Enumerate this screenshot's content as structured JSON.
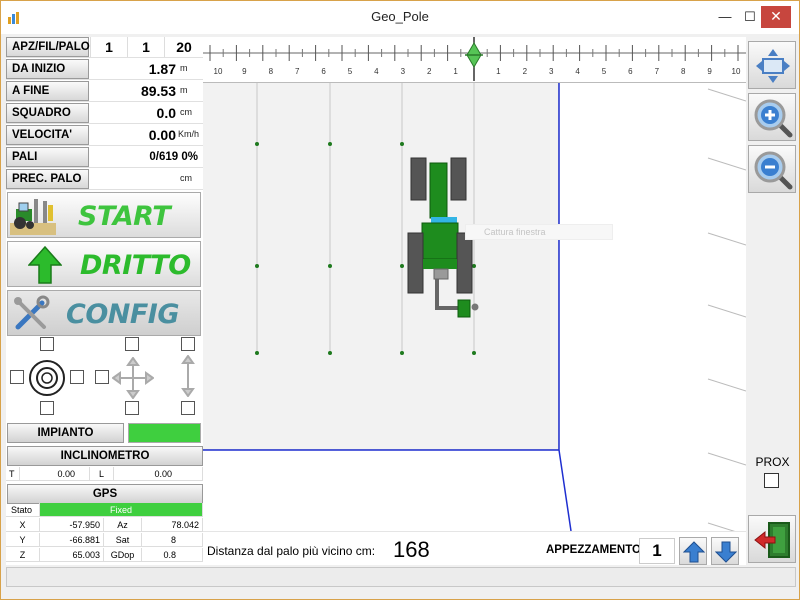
{
  "window": {
    "title": "Geo_Pole",
    "min_glyph": "—",
    "max_glyph": "☐",
    "close_glyph": "✕"
  },
  "info": {
    "apz_label": "APZ/FIL/PALO",
    "apz_values": [
      "1",
      "1",
      "20"
    ],
    "rows": [
      {
        "label": "DA INIZIO",
        "value": "1.87",
        "unit": "m"
      },
      {
        "label": "A  FINE",
        "value": "89.53",
        "unit": "m"
      },
      {
        "label": "SQUADRO",
        "value": "0.0",
        "unit": "cm"
      },
      {
        "label": "VELOCITA'",
        "value": "0.00",
        "unit": "Km/h"
      },
      {
        "label": "PALI",
        "value": "0/619 0%",
        "unit": ""
      },
      {
        "label": "PREC. PALO",
        "value": "",
        "unit": "cm"
      }
    ]
  },
  "buttons": {
    "start": "START",
    "dritto": "DRITTO",
    "config": "CONFIG"
  },
  "impianto": {
    "label": "IMPIANTO",
    "status_color": "#3fcf3f"
  },
  "inclinometro": {
    "label": "INCLINOMETRO",
    "t_label": "T",
    "t_value": "0.00",
    "l_label": "L",
    "l_value": "0.00"
  },
  "gps": {
    "label": "GPS",
    "stato_label": "Stato",
    "stato_value": "Fixed",
    "stato_color": "#3fcf3f",
    "rows": [
      {
        "k1": "X",
        "v1": "-57.950",
        "k2": "Az",
        "v2": "78.042"
      },
      {
        "k1": "Y",
        "v1": "-66.881",
        "k2": "Sat",
        "v2": "8"
      },
      {
        "k1": "Z",
        "v1": "65.003",
        "k2": "GDop",
        "v2": "0.8"
      }
    ]
  },
  "ruler": {
    "labels_left": [
      "10",
      "9",
      "8",
      "7",
      "6",
      "5",
      "4",
      "3",
      "2",
      "1"
    ],
    "labels_right": [
      "1",
      "2",
      "3",
      "4",
      "5",
      "6",
      "7",
      "8",
      "9",
      "10"
    ]
  },
  "map": {
    "capture_tooltip": "Cattura finestra",
    "accent_blue": "#1f2fd0",
    "pole_green": "#1e7a1e",
    "tractor_green": "#1e8c1e"
  },
  "right_bar": {
    "prox_label": "PROX"
  },
  "bottom": {
    "distance_label": "Distanza dal palo più vicino cm:",
    "distance_value": "168",
    "appezzamento_label": "APPEZZAMENTO",
    "appezzamento_value": "1"
  },
  "icons": {
    "start": "tractor-icon",
    "dritto": "green-up-arrow-icon",
    "config": "tools-icon",
    "zoom_in": "zoom-in-icon",
    "zoom_out": "zoom-out-icon",
    "pan": "pan-arrows-icon",
    "exit": "exit-door-icon"
  }
}
